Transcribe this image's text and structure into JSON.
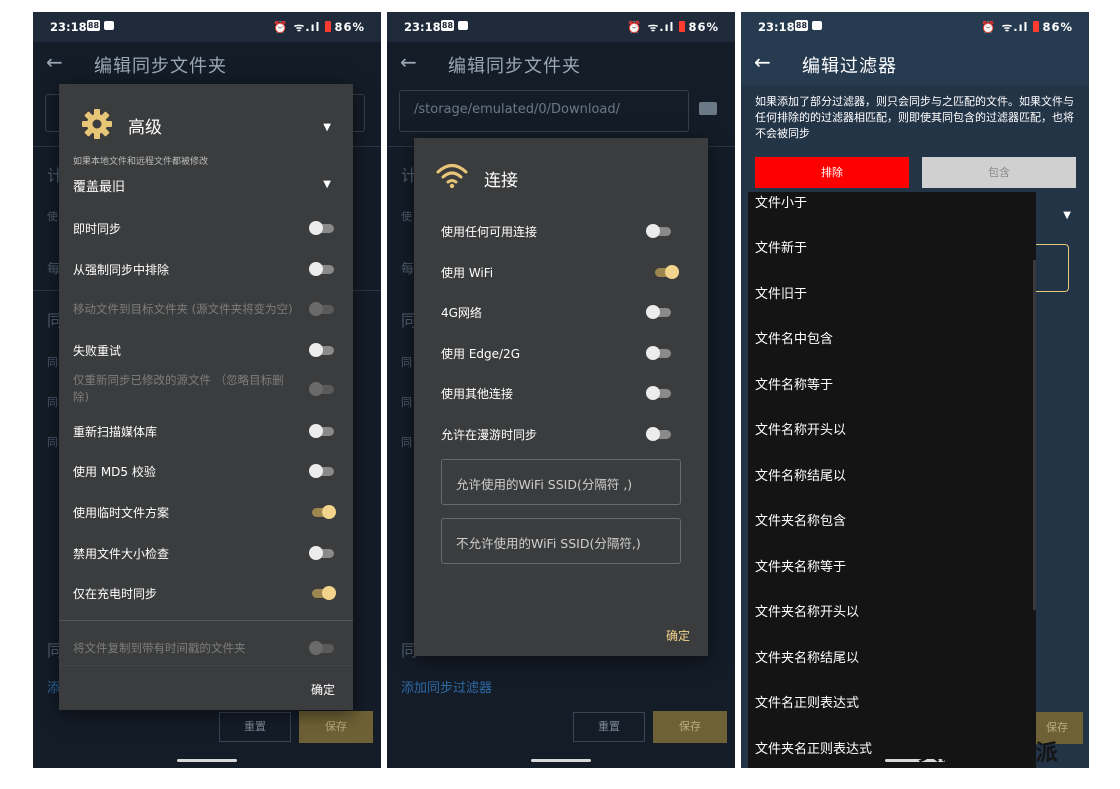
{
  "status": {
    "time": "23:18",
    "right": "⏰ ᯤ.ıl",
    "battery": "86%",
    "icon1": "88"
  },
  "screen1": {
    "appbar_title": "编辑同步文件夹",
    "bg": {
      "l1": "计",
      "l2": "使",
      "l3": "每",
      "l4": "同",
      "l5": "同",
      "l6": "同",
      "l7": "同",
      "l8": "同",
      "add": "添"
    },
    "dialog": {
      "title": "高级",
      "hint": "如果本地文件和远程文件都被修改",
      "select_value": "覆盖最旧",
      "rows": [
        {
          "label": "即时同步",
          "state": "off"
        },
        {
          "label": "从强制同步中排除",
          "state": "off"
        },
        {
          "label": "移动文件到目标文件夹 (源文件夹将变为空)",
          "state": "disabled"
        },
        {
          "label": "失败重试",
          "state": "off"
        },
        {
          "label": "仅重新同步已修改的源文件 （忽略目标删除)",
          "state": "disabled"
        },
        {
          "label": "重新扫描媒体库",
          "state": "off"
        },
        {
          "label": "使用 MD5 校验",
          "state": "off"
        },
        {
          "label": "使用临时文件方案",
          "state": "on"
        },
        {
          "label": "禁用文件大小检查",
          "state": "off"
        },
        {
          "label": "仅在充电时同步",
          "state": "on"
        },
        {
          "label": "将文件复制到带有时间戳的文件夹",
          "state": "disabled"
        }
      ],
      "ok": "确定"
    },
    "reset": "重置",
    "save": "保存"
  },
  "screen2": {
    "appbar_title": "编辑同步文件夹",
    "path": "/storage/emulated/0/Download/",
    "bg": {
      "l1": "计",
      "l2": "使",
      "l3": "每",
      "l4": "同",
      "l5": "同",
      "l6": "同",
      "l7": "同",
      "l8": "同"
    },
    "add_filter": "添加同步过滤器",
    "dialog": {
      "title": "连接",
      "rows": [
        {
          "label": "使用任何可用连接",
          "state": "off"
        },
        {
          "label": "使用 WiFi",
          "state": "on"
        },
        {
          "label": "4G网络",
          "state": "off"
        },
        {
          "label": "使用 Edge/2G",
          "state": "off"
        },
        {
          "label": "使用其他连接",
          "state": "off"
        },
        {
          "label": "允许在漫游时同步",
          "state": "off"
        }
      ],
      "field1": "允许使用的WiFi SSID(分隔符 ,)",
      "field2": "不允许使用的WiFi SSID(分隔符,)",
      "ok": "确定"
    },
    "reset": "重置",
    "save": "保存"
  },
  "screen3": {
    "appbar_title": "编辑过滤器",
    "description": "如果添加了部分过滤器，则只会同步与之匹配的文件。如果文件与任何排除的的过滤器相匹配，则即使其同包含的过滤器匹配，也将不会被同步",
    "exclude": "排除",
    "include": "包含",
    "dropdown": [
      "文件小于",
      "文件新于",
      "文件旧于",
      "文件名中包含",
      "文件名称等于",
      "文件名称开头以",
      "文件名称结尾以",
      "文件夹名称包含",
      "文件夹名称等于",
      "文件夹名称开头以",
      "文件夹名称结尾以",
      "文件名正则表达式",
      "文件夹名正则表达式"
    ],
    "save": "保存",
    "colors": {
      "exclude": "#ff0000",
      "include": "#d0d0d0"
    }
  },
  "watermark": "头条 @少数派"
}
